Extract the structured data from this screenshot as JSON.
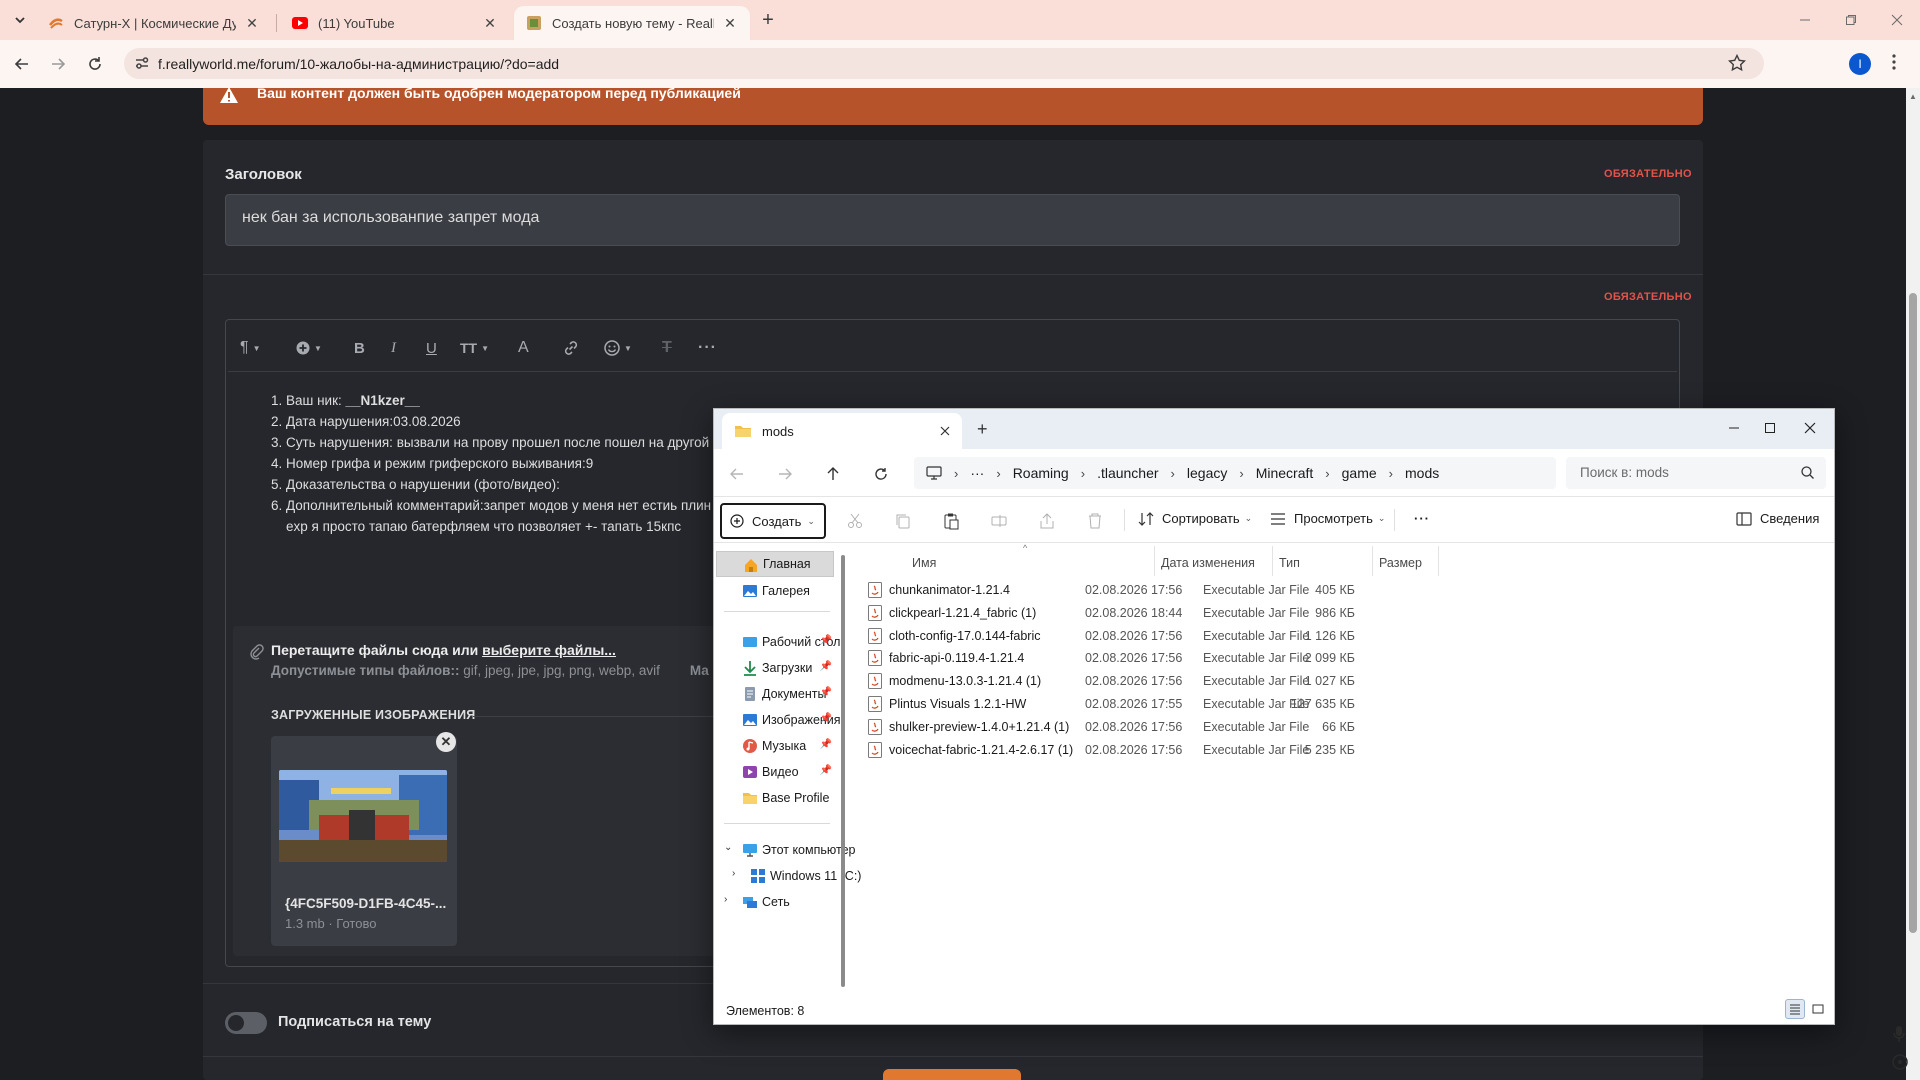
{
  "browser": {
    "tabs": [
      {
        "title": "Сатурн-X | Космические Дуэли"
      },
      {
        "title": "(11) YouTube"
      },
      {
        "title": "Создать новую тему - ReallyWorld"
      }
    ],
    "url": "f.reallyworld.me/forum/10-жалобы-на-администрацию/?do=add",
    "profile_initial": "I"
  },
  "page": {
    "notice": "Ваш контент должен быть одобрен модератором перед публикацией",
    "title_label": "Заголовок",
    "required": "ОБЯЗАТЕЛЬНО",
    "title_value": "нек бан за использованпие запрет мода",
    "editor_lines": [
      {
        "label": "Ваш ник: ",
        "value": "__N1kzer__"
      },
      {
        "label": "Дата нарушения:",
        "value": "03.08.2026"
      },
      {
        "label": "Суть нарушения: ",
        "value": "вызвали на прову прошел после пошел на другой"
      },
      {
        "label": "Номер грифа и режим гриферского выживания:",
        "value": "9"
      },
      {
        "label": "Доказательства о нарушении (фото/видео):",
        "value": ""
      },
      {
        "label": "Дополнительный комментарий:",
        "value": "запрет модов у меня нет естиь плин"
      }
    ],
    "editor_line6_cont": "exp я просто тапаю батерфляем что позволяет +- тапать 15кпс",
    "dropzone": {
      "main": "Перетащите файлы сюда или ",
      "link": "выберите файлы...",
      "types_label": "Допустимые типы файлов:: ",
      "types_value": "gif, jpeg, jpe, jpg, png, webp, avif",
      "types_more": "Ма"
    },
    "uploaded_label": "ЗАГРУЖЕННЫЕ ИЗОБРАЖЕНИЯ",
    "attachment": {
      "name": "{4FC5F509-D1FB-4C45-...",
      "meta": "1.3 mb · Готово"
    },
    "subscribe_label": "Подписаться на тему"
  },
  "explorer": {
    "tab_title": "mods",
    "breadcrumb": [
      "Roaming",
      ".tlauncher",
      "legacy",
      "Minecraft",
      "game",
      "mods"
    ],
    "ellipsis": "···",
    "search_placeholder": "Поиск в: mods",
    "toolbar": {
      "create": "Создать",
      "sort": "Сортировать",
      "view": "Просмотреть",
      "more": "···",
      "details": "Сведения"
    },
    "nav": {
      "home": "Главная",
      "gallery": "Галерея",
      "desktop": "Рабочий стол",
      "downloads": "Загрузки",
      "documents": "Документы",
      "pictures": "Изображения",
      "music": "Музыка",
      "video": "Видео",
      "base_profile": "Base Profile",
      "this_pc": "Этот компьютер",
      "windows": "Windows 11 (C:)",
      "network": "Сеть"
    },
    "columns": {
      "name": "Имя",
      "date": "Дата изменения",
      "type": "Тип",
      "size": "Размер"
    },
    "files": [
      {
        "name": "chunkanimator-1.21.4",
        "date": "02.08.2026 17:56",
        "type": "Executable Jar File",
        "size": "405 КБ"
      },
      {
        "name": "clickpearl-1.21.4_fabric (1)",
        "date": "02.08.2026 18:44",
        "type": "Executable Jar File",
        "size": "986 КБ"
      },
      {
        "name": "cloth-config-17.0.144-fabric",
        "date": "02.08.2026 17:56",
        "type": "Executable Jar File",
        "size": "1 126 КБ"
      },
      {
        "name": "fabric-api-0.119.4-1.21.4",
        "date": "02.08.2026 17:56",
        "type": "Executable Jar File",
        "size": "2 099 КБ"
      },
      {
        "name": "modmenu-13.0.3-1.21.4 (1)",
        "date": "02.08.2026 17:56",
        "type": "Executable Jar File",
        "size": "1 027 КБ"
      },
      {
        "name": "Plintus Visuals 1.2.1-HW",
        "date": "02.08.2026 17:55",
        "type": "Executable Jar File",
        "size": "127 635 КБ"
      },
      {
        "name": "shulker-preview-1.4.0+1.21.4 (1)",
        "date": "02.08.2026 17:56",
        "type": "Executable Jar File",
        "size": "66 КБ"
      },
      {
        "name": "voicechat-fabric-1.21.4-2.6.17 (1)",
        "date": "02.08.2026 17:56",
        "type": "Executable Jar File",
        "size": "5 235 КБ"
      }
    ],
    "status": "Элементов: 8"
  },
  "colors": {
    "accent": "#b7532a",
    "required": "#e2534b",
    "chrome_tab": "#f9dfd8"
  }
}
